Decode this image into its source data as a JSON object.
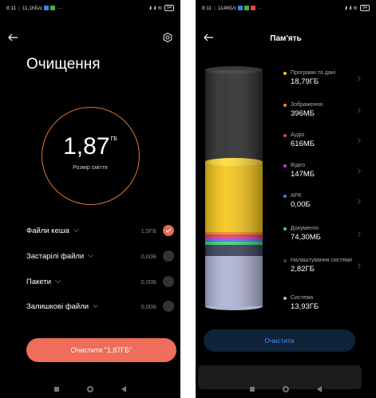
{
  "left": {
    "status": {
      "time": "8:11",
      "speed": "11,1КБ/с",
      "extra": "···",
      "battery": "94"
    },
    "title": "Очищення",
    "summary": {
      "value": "1,87",
      "unit": "ГБ",
      "caption": "Розмір сміття"
    },
    "rows": [
      {
        "label": "Файли кеша",
        "size": "1,5ГБ",
        "checked": true
      },
      {
        "label": "Застарілі файли",
        "size": "0,00Б",
        "checked": false
      },
      {
        "label": "Пакети",
        "size": "0,00Б",
        "checked": false
      },
      {
        "label": "Залишкові файли",
        "size": "0,00Б",
        "checked": false
      }
    ],
    "clean_button": "Очистити \"1,87ГБ\""
  },
  "right": {
    "status": {
      "time": "8:11",
      "speed": "114КБ/с",
      "extra": "··",
      "battery": "94"
    },
    "title": "Пам'ять",
    "clean_button": "Очистити",
    "categories": [
      {
        "label": "Програми та дані",
        "value": "18,79ГБ",
        "color": "#f5c518"
      },
      {
        "label": "Зображення",
        "value": "396МБ",
        "color": "#f2852a"
      },
      {
        "label": "Аудіо",
        "value": "616МБ",
        "color": "#e6414a"
      },
      {
        "label": "Відео",
        "value": "147МБ",
        "color": "#c040d8"
      },
      {
        "label": "APK",
        "value": "0,00Б",
        "color": "#3f7fe0"
      },
      {
        "label": "Документи",
        "value": "74,30МБ",
        "color": "#3fd17f"
      },
      {
        "label": "Налаштування системи",
        "value": "2,82ГБ",
        "color": "#3a3f58"
      },
      {
        "label": "Система",
        "value": "13,93ГБ",
        "color": "#b0b4d4"
      }
    ]
  },
  "colors": {
    "accent": "#ef6d5b",
    "blue": "#3f8cff",
    "ring": "#e07835"
  }
}
